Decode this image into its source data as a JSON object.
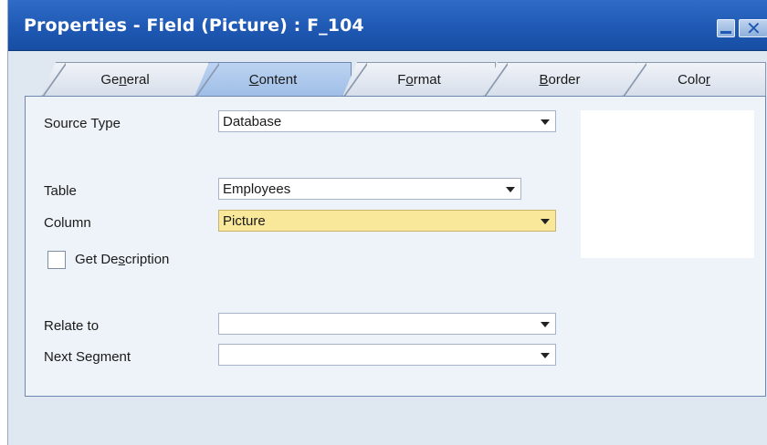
{
  "window": {
    "title": "Properties - Field (Picture) : F_104",
    "minimize_label": "",
    "close_glyph": "✕"
  },
  "tabs": [
    {
      "label": "General",
      "mnemonic": "n",
      "active": false
    },
    {
      "label": "Content",
      "mnemonic": "C",
      "active": true
    },
    {
      "label": "Format",
      "mnemonic": "o",
      "active": false
    },
    {
      "label": "Border",
      "mnemonic": "B",
      "active": false
    },
    {
      "label": "Color",
      "mnemonic": "r",
      "active": false
    }
  ],
  "content": {
    "source_type": {
      "label": "Source Type",
      "value": "Database"
    },
    "table": {
      "label": "Table",
      "value": "Employees"
    },
    "column": {
      "label": "Column",
      "value": "Picture"
    },
    "get_description": {
      "label": "Get Description",
      "checked": false
    },
    "relate_to": {
      "label": "Relate to",
      "value": ""
    },
    "next_segment": {
      "label": "Next Segment",
      "value": ""
    }
  },
  "colors": {
    "titlebar": "#1f59b4",
    "active_tab": "#a9c5ea",
    "highlight_field": "#f9e79a"
  }
}
